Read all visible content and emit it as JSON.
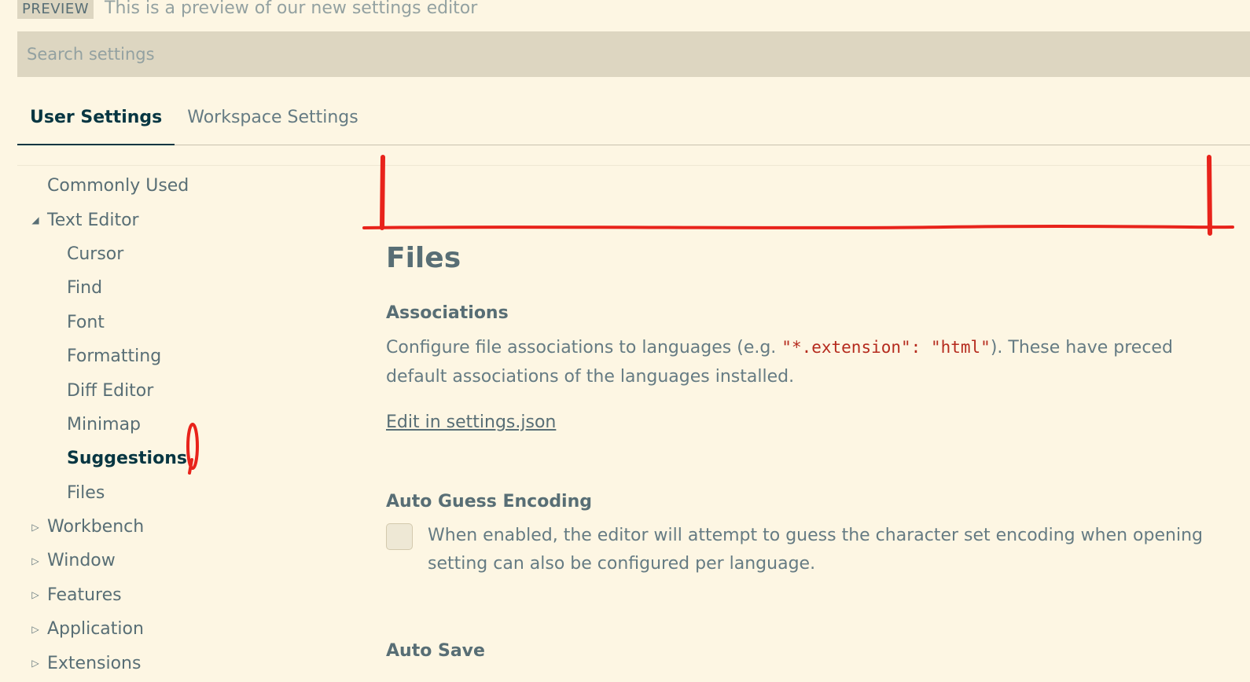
{
  "banner": {
    "badge": "PREVIEW",
    "text": "This is a preview of our new settings editor"
  },
  "search": {
    "placeholder": "Search settings"
  },
  "tabs": [
    {
      "label": "User Settings",
      "active": true
    },
    {
      "label": "Workspace Settings",
      "active": false
    }
  ],
  "toc": {
    "items": [
      {
        "label": "Commonly Used",
        "level": 1,
        "arrow": ""
      },
      {
        "label": "Text Editor",
        "level": 1,
        "arrow": "expanded"
      },
      {
        "label": "Cursor",
        "level": 2
      },
      {
        "label": "Find",
        "level": 2
      },
      {
        "label": "Font",
        "level": 2
      },
      {
        "label": "Formatting",
        "level": 2
      },
      {
        "label": "Diff Editor",
        "level": 2
      },
      {
        "label": "Minimap",
        "level": 2
      },
      {
        "label": "Suggestions",
        "level": 2,
        "selected": true
      },
      {
        "label": "Files",
        "level": 2
      },
      {
        "label": "Workbench",
        "level": 1,
        "arrow": "collapsed"
      },
      {
        "label": "Window",
        "level": 1,
        "arrow": "collapsed"
      },
      {
        "label": "Features",
        "level": 1,
        "arrow": "collapsed"
      },
      {
        "label": "Application",
        "level": 1,
        "arrow": "collapsed"
      },
      {
        "label": "Extensions",
        "level": 1,
        "arrow": "collapsed"
      }
    ]
  },
  "main": {
    "section_title": "Files",
    "associations": {
      "label": "Associations",
      "desc_line1_pre": "Configure file associations to languages (e.g. ",
      "desc_code": "\"*.extension\": \"html\"",
      "desc_line1_post": "). These have preced",
      "desc_line2": "default associations of the languages installed.",
      "edit_link": "Edit in settings.json"
    },
    "auto_guess_encoding": {
      "label": "Auto Guess Encoding",
      "desc_line1": "When enabled, the editor will attempt to guess the character set encoding when opening",
      "desc_line2": "setting can also be configured per language.",
      "checked": false
    },
    "auto_save": {
      "label": "Auto Save"
    }
  },
  "colors": {
    "background": "#fdf6e3",
    "search_bg": "#ddd6c1",
    "annotation": "#e8231b",
    "code": "#b52a1d"
  }
}
